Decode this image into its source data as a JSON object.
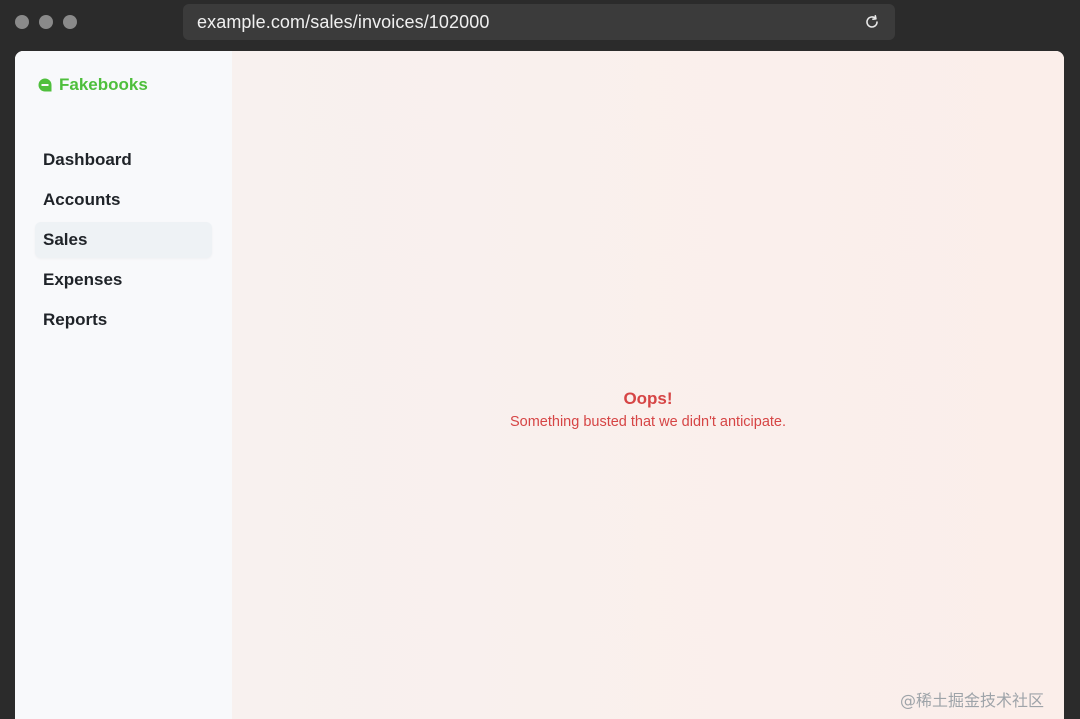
{
  "browser": {
    "url": "example.com/sales/invoices/102000",
    "reload_icon": "reload-icon"
  },
  "sidebar": {
    "brand": "Fakebooks",
    "brand_color": "#4fbf3c",
    "items": [
      {
        "label": "Dashboard",
        "active": false
      },
      {
        "label": "Accounts",
        "active": false
      },
      {
        "label": "Sales",
        "active": true
      },
      {
        "label": "Expenses",
        "active": false
      },
      {
        "label": "Reports",
        "active": false
      }
    ]
  },
  "main": {
    "error_title": "Oops!",
    "error_message": "Something busted that we didn't anticipate.",
    "error_color": "#d64545"
  },
  "watermark": "@稀土掘金技术社区"
}
